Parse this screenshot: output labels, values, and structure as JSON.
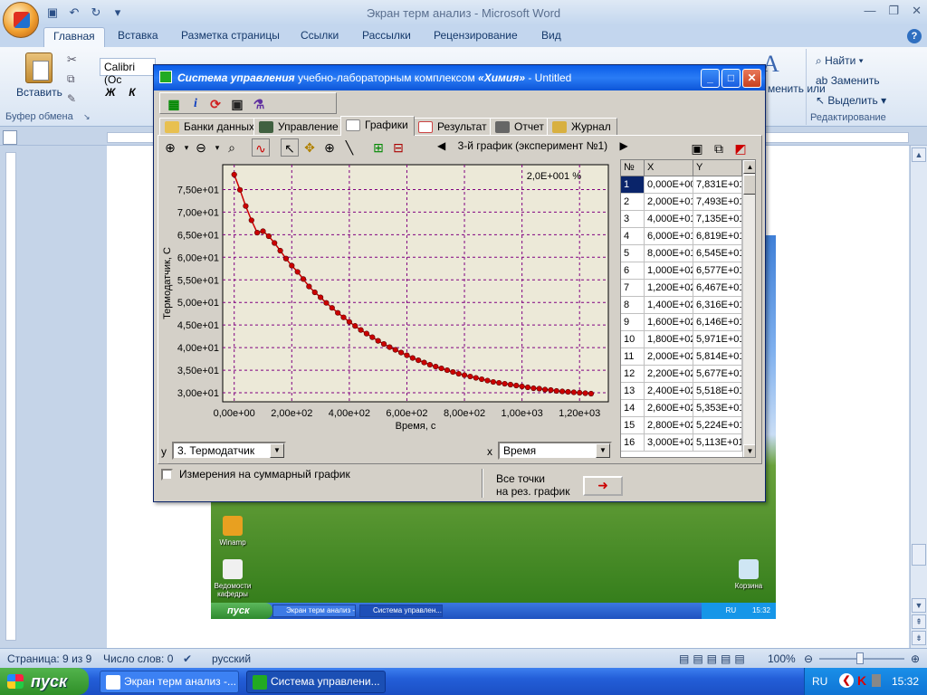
{
  "word": {
    "title": "Экран терм анализ - Microsoft Word",
    "tabs": [
      "Главная",
      "Вставка",
      "Разметка страницы",
      "Ссылки",
      "Рассылки",
      "Рецензирование",
      "Вид"
    ],
    "groups": {
      "clipboard": "Буфер обмена",
      "editing": "Редактирование"
    },
    "paste_label": "Вставить",
    "font_name": "Calibri (Oc",
    "bold": "Ж",
    "italic": "К",
    "styles_partial": "менить\nили",
    "editing_items": [
      "Найти",
      "Заменить",
      "Выделить"
    ],
    "status": {
      "page": "Страница: 9 из 9",
      "words": "Число слов: 0",
      "lang": "русский",
      "zoom": "100%"
    }
  },
  "desktop": {
    "icons": [
      {
        "label": "Winamp"
      },
      {
        "label": "Ведомости кафедры"
      },
      {
        "label": "Корзина"
      }
    ],
    "start": "пуск",
    "tasks": [
      "Экран терм анализ -...",
      "Система управлен..."
    ],
    "tray_lang": "RU",
    "clock": "15:32"
  },
  "taskbar": {
    "start": "пуск",
    "tasks": [
      "Экран терм анализ -...",
      "Система управлени..."
    ],
    "lang": "RU",
    "clock": "15:32"
  },
  "app": {
    "title_prefix": "Система управления",
    "title_mid": " учебно-лабораторным комплексом ",
    "title_name": "«Химия»",
    "title_suffix": " - Untitled",
    "tabs": [
      "Банки данных",
      "Управление",
      "Графики",
      "Результат",
      "Отчет",
      "Журнал"
    ],
    "graph_nav": "3-й график (эксперимент №1)",
    "percent_label": "2,0E+001 %",
    "y_axis_select": "3. Термодатчик",
    "x_axis_select": "Время",
    "y_select_prefix": "y",
    "x_select_prefix": "x",
    "checkbox_label": "Измерения на суммарный график",
    "all_points_label": "Все точки",
    "to_result_label": "на рез. график",
    "table_headers": [
      "№",
      "X",
      "Y"
    ],
    "table_rows": [
      [
        "1",
        "0,000E+00",
        "7,831E+01"
      ],
      [
        "2",
        "2,000E+01",
        "7,493E+01"
      ],
      [
        "3",
        "4,000E+01",
        "7,135E+01"
      ],
      [
        "4",
        "6,000E+01",
        "6,819E+01"
      ],
      [
        "5",
        "8,000E+01",
        "6,545E+01"
      ],
      [
        "6",
        "1,000E+02",
        "6,577E+01"
      ],
      [
        "7",
        "1,200E+02",
        "6,467E+01"
      ],
      [
        "8",
        "1,400E+02",
        "6,316E+01"
      ],
      [
        "9",
        "1,600E+02",
        "6,146E+01"
      ],
      [
        "10",
        "1,800E+02",
        "5,971E+01"
      ],
      [
        "11",
        "2,000E+02",
        "5,814E+01"
      ],
      [
        "12",
        "2,200E+02",
        "5,677E+01"
      ],
      [
        "13",
        "2,400E+02",
        "5,518E+01"
      ],
      [
        "14",
        "2,600E+02",
        "5,353E+01"
      ],
      [
        "15",
        "2,800E+02",
        "5,224E+01"
      ],
      [
        "16",
        "3,000E+02",
        "5,113E+01"
      ]
    ]
  },
  "chart_data": {
    "type": "line",
    "xlabel": "Время, с",
    "ylabel": "Термодатчик, С",
    "xlim": [
      -40,
      1300
    ],
    "ylim": [
      28,
      80.5
    ],
    "xticks": [
      0,
      200,
      400,
      600,
      800,
      1000,
      1200
    ],
    "xtick_labels": [
      "0,00e+00",
      "2,00e+02",
      "4,00e+02",
      "6,00e+02",
      "8,00e+02",
      "1,00e+03",
      "1,20e+03"
    ],
    "yticks": [
      30,
      35,
      40,
      45,
      50,
      55,
      60,
      65,
      70,
      75
    ],
    "ytick_labels": [
      "3,00e+01",
      "3,50e+01",
      "4,00e+01",
      "4,50e+01",
      "5,00e+01",
      "5,50e+01",
      "6,00e+01",
      "6,50e+01",
      "7,00e+01",
      "7,50e+01"
    ],
    "grid": true,
    "color": "#cc0000",
    "series": [
      {
        "x": [
          0,
          20,
          40,
          60,
          80,
          100,
          120,
          140,
          160,
          180,
          200,
          220,
          240,
          260,
          280,
          300,
          320,
          340,
          360,
          380,
          400,
          420,
          440,
          460,
          480,
          500,
          520,
          540,
          560,
          580,
          600,
          620,
          640,
          660,
          680,
          700,
          720,
          740,
          760,
          780,
          800,
          820,
          840,
          860,
          880,
          900,
          920,
          940,
          960,
          980,
          1000,
          1020,
          1040,
          1060,
          1080,
          1100,
          1120,
          1140,
          1160,
          1180,
          1200,
          1220,
          1240
        ],
        "y": [
          78.31,
          74.93,
          71.35,
          68.19,
          65.45,
          65.77,
          64.67,
          63.16,
          61.46,
          59.71,
          58.14,
          56.77,
          55.18,
          53.53,
          52.24,
          51.13,
          49.9,
          48.8,
          47.7,
          46.7,
          45.7,
          44.8,
          43.9,
          43.1,
          42.3,
          41.5,
          40.8,
          40.1,
          39.5,
          38.9,
          38.3,
          37.7,
          37.2,
          36.7,
          36.2,
          35.8,
          35.4,
          35.0,
          34.6,
          34.2,
          33.9,
          33.6,
          33.3,
          33.0,
          32.7,
          32.4,
          32.2,
          32.0,
          31.8,
          31.6,
          31.4,
          31.2,
          31.0,
          30.9,
          30.7,
          30.6,
          30.4,
          30.3,
          30.2,
          30.1,
          30.0,
          29.9,
          29.8
        ]
      }
    ]
  }
}
